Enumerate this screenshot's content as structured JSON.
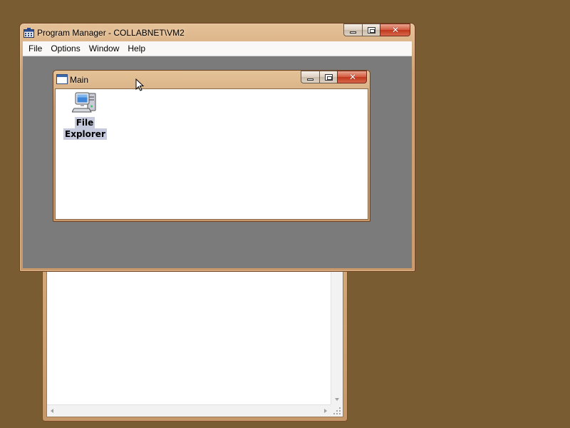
{
  "desktop": {
    "background_color": "#7a5c33"
  },
  "program_manager": {
    "title": "Program Manager - COLLABNET\\VM2",
    "menu": [
      "File",
      "Options",
      "Window",
      "Help"
    ],
    "client_color": "#7b7b7b",
    "icons": {
      "app": "program-manager-icon",
      "minimize": "minimize-icon",
      "maximize": "maximize-icon",
      "close": "close-icon",
      "close_glyph": "✕"
    }
  },
  "main_window": {
    "title": "Main",
    "icons": {
      "window": "window-icon",
      "close_glyph": "✕"
    },
    "programs": [
      {
        "label_line1": "File",
        "label_line2": "Explorer",
        "icon": "computer-icon"
      }
    ]
  },
  "background_window": {
    "scrollbars": [
      "vertical",
      "horizontal"
    ]
  }
}
